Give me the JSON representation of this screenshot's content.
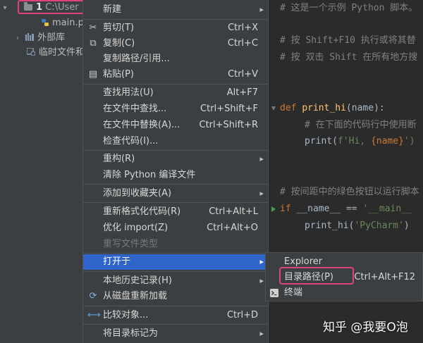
{
  "project_tree": {
    "root_prefix": "1",
    "root_path": "C:\\User",
    "file_name": "main.p",
    "external_libraries": "外部库",
    "scratches": "临时文件和"
  },
  "context_menu": {
    "items": [
      {
        "label": "新建",
        "shortcut": "",
        "submenu": true,
        "icon": ""
      },
      {
        "label": "剪切(T)",
        "shortcut": "Ctrl+X",
        "icon": "scissors-icon"
      },
      {
        "label": "复制(C)",
        "shortcut": "Ctrl+C",
        "icon": "copy-icon"
      },
      {
        "label": "复制路径/引用...",
        "shortcut": "",
        "icon": ""
      },
      {
        "label": "粘贴(P)",
        "shortcut": "Ctrl+V",
        "icon": "paste-icon"
      },
      {
        "label": "查找用法(U)",
        "shortcut": "Alt+F7",
        "icon": ""
      },
      {
        "label": "在文件中查找...",
        "shortcut": "Ctrl+Shift+F",
        "icon": ""
      },
      {
        "label": "在文件中替换(A)...",
        "shortcut": "Ctrl+Shift+R",
        "icon": ""
      },
      {
        "label": "检查代码(I)...",
        "shortcut": "",
        "icon": ""
      },
      {
        "label": "重构(R)",
        "shortcut": "",
        "submenu": true,
        "icon": ""
      },
      {
        "label": "清除 Python 编译文件",
        "shortcut": "",
        "icon": ""
      },
      {
        "label": "添加到收藏夹(A)",
        "shortcut": "",
        "submenu": true,
        "icon": ""
      },
      {
        "label": "重新格式化代码(R)",
        "shortcut": "Ctrl+Alt+L",
        "icon": ""
      },
      {
        "label": "优化 import(Z)",
        "shortcut": "Ctrl+Alt+O",
        "icon": ""
      },
      {
        "label": "重写文件类型",
        "shortcut": "",
        "disabled": true,
        "icon": ""
      },
      {
        "label": "打开于",
        "shortcut": "",
        "submenu": true,
        "selected": true,
        "icon": ""
      },
      {
        "label": "本地历史记录(H)",
        "shortcut": "",
        "submenu": true,
        "icon": ""
      },
      {
        "label": "从磁盘重新加载",
        "shortcut": "",
        "icon": "reload-icon"
      },
      {
        "label": "比较对象...",
        "shortcut": "Ctrl+D",
        "icon": "compare-icon"
      },
      {
        "label": "将目录标记为",
        "shortcut": "",
        "submenu": true,
        "icon": ""
      }
    ]
  },
  "open_in_submenu": {
    "items": [
      {
        "label": "Explorer",
        "shortcut": ""
      },
      {
        "label": "目录路径(P)",
        "shortcut": "Ctrl+Alt+F12"
      },
      {
        "label": "终端",
        "shortcut": "",
        "icon": "terminal-icon"
      }
    ]
  },
  "editor": {
    "line1": "# 这是一个示例 Python 脚本。",
    "line2": "# 按 Shift+F10 执行或将其替",
    "line3": "# 按 双击 Shift 在所有地方搜",
    "def_kw": "def",
    "fn_name": "print_hi",
    "params": "(name):",
    "comment_inner": "# 在下面的代码行中使用断",
    "print1_fn": "print(",
    "print1_str": "f'Hi, ",
    "print1_brace": "{name}",
    "print1_end": "')",
    "comment_main": "# 按间距中的绿色按钮以运行脚本",
    "if_kw": "if",
    "if_cond": " __name__ == ",
    "if_str": "'__main__",
    "print2_fn": "print_hi(",
    "print2_str": "'PyCharm'",
    "print2_end": ")"
  },
  "watermark": "知乎 @我要O泡"
}
